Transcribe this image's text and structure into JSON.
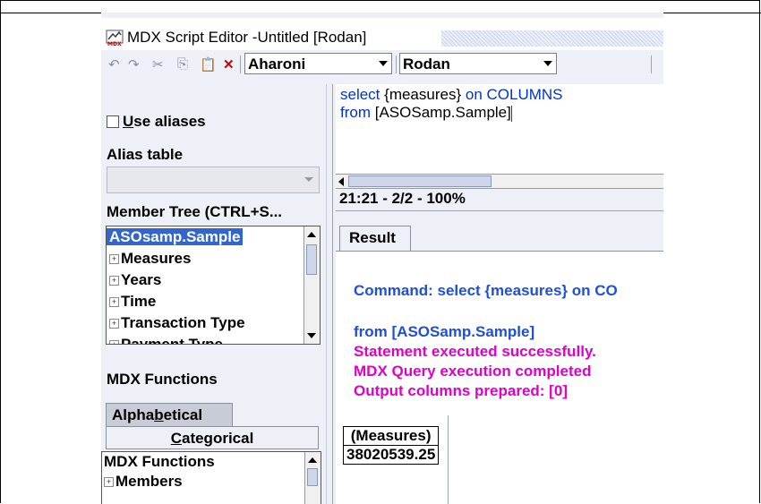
{
  "window": {
    "title": "MDX Script Editor -Untitled [Rodan]"
  },
  "toolbar": {
    "icons": [
      "undo-icon",
      "redo-icon",
      "cut-icon",
      "copy-icon",
      "paste-icon",
      "delete-icon"
    ],
    "font_combo": "Aharoni",
    "server_combo": "Rodan"
  },
  "left": {
    "use_aliases_label_pre": "",
    "use_aliases_label_u": "U",
    "use_aliases_label_post": "se aliases",
    "use_aliases_checked": false,
    "alias_table_label": "Alias table",
    "alias_table_value": "",
    "member_tree_label": "Member Tree (CTRL+S...",
    "member_tree": {
      "root": "ASOsamp.Sample",
      "children": [
        "Measures",
        "Years",
        "Time",
        "Transaction Type",
        "Payment Type"
      ]
    },
    "mdx_functions_label": "MDX Functions",
    "tabs": {
      "alpha_pre": "Alpha",
      "alpha_u": "b",
      "alpha_post": "etical",
      "cat_u": "C",
      "cat_post": "ategorical"
    },
    "function_list": {
      "root": "MDX Functions",
      "children": [
        "Members"
      ]
    }
  },
  "editor": {
    "line1_kw1": "select ",
    "line1_plain": "{measures}",
    "line1_kw2": " on COLUMNS",
    "line2_kw": "from ",
    "line2_plain": "[ASOSamp.Sample]",
    "status": "21:21 - 2/2 - 100%"
  },
  "result": {
    "tab_label": "Result",
    "command": "Command: select {measures} on CO",
    "from_line": "from [ASOSamp.Sample]",
    "msg1": "Statement executed successfully.",
    "msg2": "MDX Query execution completed",
    "msg3": "Output columns prepared: [0]",
    "table_header": "(Measures)",
    "table_value": "38020539.25"
  },
  "colors": {
    "selection": "#3366cc",
    "keyword_blue": "#0033cc",
    "result_blue": "#1f4fd8",
    "result_magenta": "#e000c8",
    "delete_red": "#d00000"
  }
}
